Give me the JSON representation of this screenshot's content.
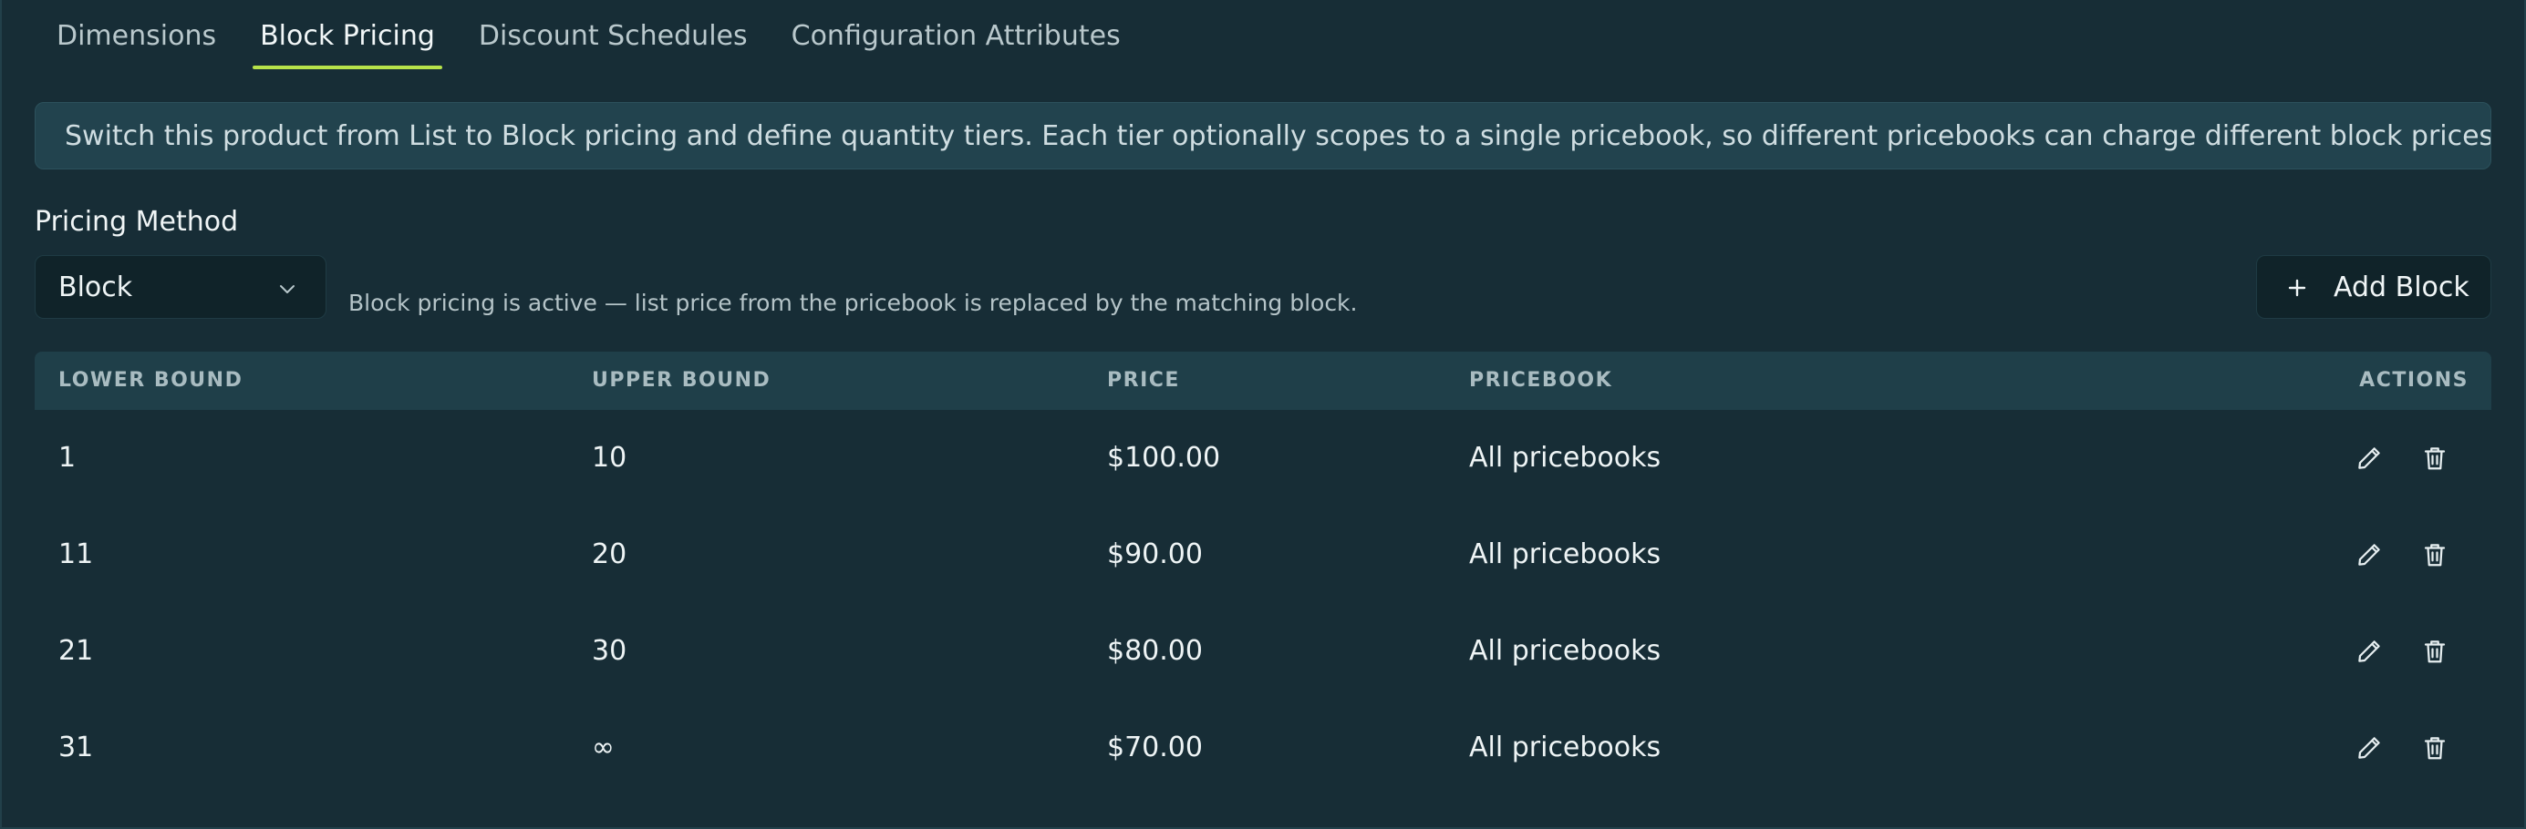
{
  "tabs": [
    {
      "label": "Dimensions",
      "active": false
    },
    {
      "label": "Block Pricing",
      "active": true
    },
    {
      "label": "Discount Schedules",
      "active": false
    },
    {
      "label": "Configuration Attributes",
      "active": false
    }
  ],
  "banner": {
    "text": "Switch this product from List to Block pricing and define quantity tiers. Each tier optionally scopes to a single pricebook, so different pricebooks can charge different block prices."
  },
  "pricing_method": {
    "label": "Pricing Method",
    "selected": "Block",
    "helper": "Block pricing is active — list price from the pricebook is replaced by the matching block."
  },
  "add_button": {
    "label": "Add Block",
    "icon": "plus-icon"
  },
  "table": {
    "headers": {
      "lower": "LOWER BOUND",
      "upper": "UPPER BOUND",
      "price": "PRICE",
      "pricebook": "PRICEBOOK",
      "actions": "ACTIONS"
    },
    "rows": [
      {
        "lower": "1",
        "upper": "10",
        "price": "$100.00",
        "pricebook": "All pricebooks"
      },
      {
        "lower": "11",
        "upper": "20",
        "price": "$90.00",
        "pricebook": "All pricebooks"
      },
      {
        "lower": "21",
        "upper": "30",
        "price": "$80.00",
        "pricebook": "All pricebooks"
      },
      {
        "lower": "31",
        "upper": "∞",
        "price": "$70.00",
        "pricebook": "All pricebooks"
      }
    ],
    "row_actions": [
      "pencil-icon",
      "trash-icon"
    ]
  },
  "colors": {
    "accent": "#b7e24a",
    "background": "#172d36",
    "banner": "#22434e",
    "header": "#1f3f49"
  }
}
